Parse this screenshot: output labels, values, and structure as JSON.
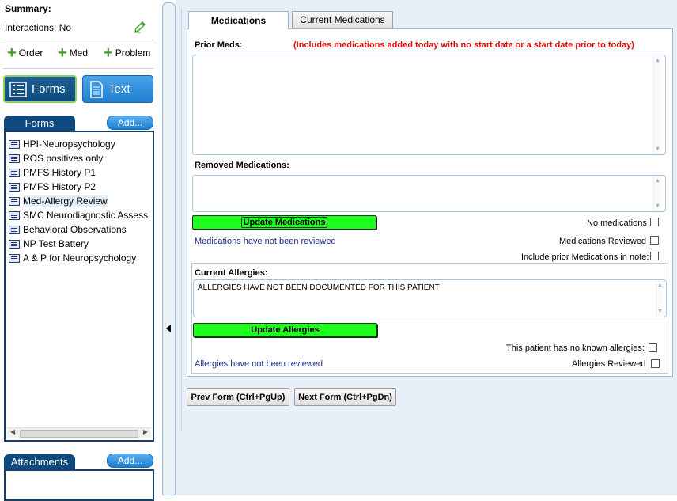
{
  "left": {
    "summary_title": "Summary:",
    "interactions": "Interactions: No",
    "actions": {
      "order": "Order",
      "med": "Med",
      "problem": "Problem"
    },
    "forms_button": "Forms",
    "text_button": "Text",
    "forms_header": "Forms",
    "forms_add": "Add...",
    "forms_list": [
      "HPI-Neuropsychology",
      "ROS positives only",
      "PMFS History P1",
      "PMFS History P2",
      "Med-Allergy Review",
      "SMC Neurodiagnostic Assess",
      "Behavioral Observations",
      "NP Test Battery",
      "A & P for Neuropsychology"
    ],
    "selected_form_index": 4,
    "attachments_header": "Attachments",
    "attachments_add": "Add..."
  },
  "right": {
    "tabs": [
      "Medications",
      "Current Medications"
    ],
    "active_tab": 0,
    "prior_meds_label": "Prior Meds:",
    "prior_meds_note": "(Includes medications added today with no start date or a start date prior to today)",
    "prior_meds_value": "",
    "removed_meds_label": "Removed Medications:",
    "removed_meds_value": "",
    "update_meds_button": "Update Medications",
    "no_medications_label": "No medications",
    "meds_not_reviewed": "Medications have not been reviewed",
    "meds_reviewed_label": "Medications Reviewed",
    "include_prior_label": "Include prior Medications in note:",
    "current_allergies_label": "Current Allergies:",
    "allergies_value": "ALLERGIES HAVE NOT BEEN DOCUMENTED FOR THIS PATIENT",
    "update_allergies_button": "Update Allergies",
    "no_known_allergies_label": "This patient has no known allergies:",
    "allergies_not_reviewed": "Allergies have not been reviewed",
    "allergies_reviewed_label": "Allergies Reviewed",
    "prev_form_button": "Prev Form (Ctrl+PgUp)",
    "next_form_button": "Next Form (Ctrl+PgDn)"
  },
  "colors": {
    "accent_dark": "#0f4a7e",
    "accent_light": "#1f7fcf",
    "green_button": "#1dff1d",
    "warning_red": "#e01010",
    "status_blue": "#1a2f8a"
  }
}
